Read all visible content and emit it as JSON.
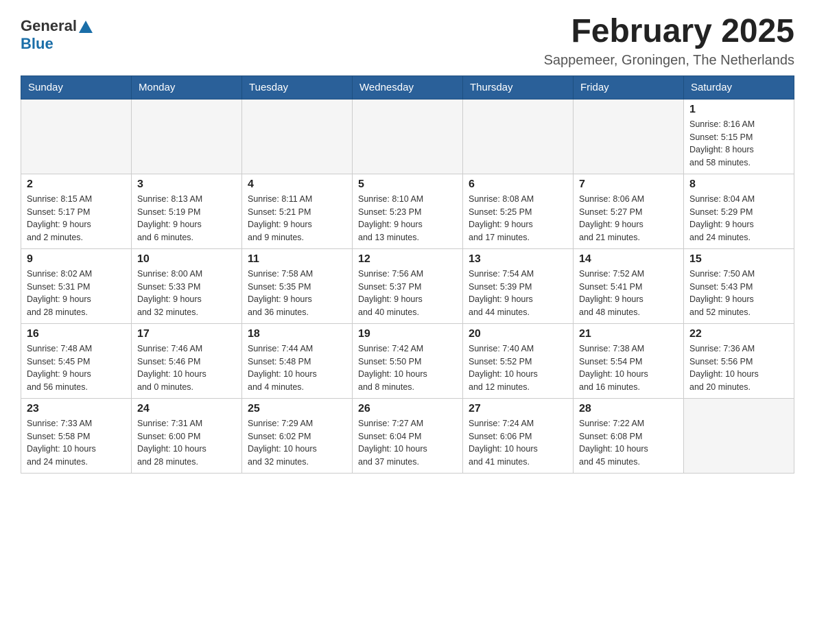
{
  "header": {
    "logo_general": "General",
    "logo_blue": "Blue",
    "title": "February 2025",
    "subtitle": "Sappemeer, Groningen, The Netherlands"
  },
  "weekdays": [
    "Sunday",
    "Monday",
    "Tuesday",
    "Wednesday",
    "Thursday",
    "Friday",
    "Saturday"
  ],
  "weeks": [
    [
      {
        "day": "",
        "info": ""
      },
      {
        "day": "",
        "info": ""
      },
      {
        "day": "",
        "info": ""
      },
      {
        "day": "",
        "info": ""
      },
      {
        "day": "",
        "info": ""
      },
      {
        "day": "",
        "info": ""
      },
      {
        "day": "1",
        "info": "Sunrise: 8:16 AM\nSunset: 5:15 PM\nDaylight: 8 hours\nand 58 minutes."
      }
    ],
    [
      {
        "day": "2",
        "info": "Sunrise: 8:15 AM\nSunset: 5:17 PM\nDaylight: 9 hours\nand 2 minutes."
      },
      {
        "day": "3",
        "info": "Sunrise: 8:13 AM\nSunset: 5:19 PM\nDaylight: 9 hours\nand 6 minutes."
      },
      {
        "day": "4",
        "info": "Sunrise: 8:11 AM\nSunset: 5:21 PM\nDaylight: 9 hours\nand 9 minutes."
      },
      {
        "day": "5",
        "info": "Sunrise: 8:10 AM\nSunset: 5:23 PM\nDaylight: 9 hours\nand 13 minutes."
      },
      {
        "day": "6",
        "info": "Sunrise: 8:08 AM\nSunset: 5:25 PM\nDaylight: 9 hours\nand 17 minutes."
      },
      {
        "day": "7",
        "info": "Sunrise: 8:06 AM\nSunset: 5:27 PM\nDaylight: 9 hours\nand 21 minutes."
      },
      {
        "day": "8",
        "info": "Sunrise: 8:04 AM\nSunset: 5:29 PM\nDaylight: 9 hours\nand 24 minutes."
      }
    ],
    [
      {
        "day": "9",
        "info": "Sunrise: 8:02 AM\nSunset: 5:31 PM\nDaylight: 9 hours\nand 28 minutes."
      },
      {
        "day": "10",
        "info": "Sunrise: 8:00 AM\nSunset: 5:33 PM\nDaylight: 9 hours\nand 32 minutes."
      },
      {
        "day": "11",
        "info": "Sunrise: 7:58 AM\nSunset: 5:35 PM\nDaylight: 9 hours\nand 36 minutes."
      },
      {
        "day": "12",
        "info": "Sunrise: 7:56 AM\nSunset: 5:37 PM\nDaylight: 9 hours\nand 40 minutes."
      },
      {
        "day": "13",
        "info": "Sunrise: 7:54 AM\nSunset: 5:39 PM\nDaylight: 9 hours\nand 44 minutes."
      },
      {
        "day": "14",
        "info": "Sunrise: 7:52 AM\nSunset: 5:41 PM\nDaylight: 9 hours\nand 48 minutes."
      },
      {
        "day": "15",
        "info": "Sunrise: 7:50 AM\nSunset: 5:43 PM\nDaylight: 9 hours\nand 52 minutes."
      }
    ],
    [
      {
        "day": "16",
        "info": "Sunrise: 7:48 AM\nSunset: 5:45 PM\nDaylight: 9 hours\nand 56 minutes."
      },
      {
        "day": "17",
        "info": "Sunrise: 7:46 AM\nSunset: 5:46 PM\nDaylight: 10 hours\nand 0 minutes."
      },
      {
        "day": "18",
        "info": "Sunrise: 7:44 AM\nSunset: 5:48 PM\nDaylight: 10 hours\nand 4 minutes."
      },
      {
        "day": "19",
        "info": "Sunrise: 7:42 AM\nSunset: 5:50 PM\nDaylight: 10 hours\nand 8 minutes."
      },
      {
        "day": "20",
        "info": "Sunrise: 7:40 AM\nSunset: 5:52 PM\nDaylight: 10 hours\nand 12 minutes."
      },
      {
        "day": "21",
        "info": "Sunrise: 7:38 AM\nSunset: 5:54 PM\nDaylight: 10 hours\nand 16 minutes."
      },
      {
        "day": "22",
        "info": "Sunrise: 7:36 AM\nSunset: 5:56 PM\nDaylight: 10 hours\nand 20 minutes."
      }
    ],
    [
      {
        "day": "23",
        "info": "Sunrise: 7:33 AM\nSunset: 5:58 PM\nDaylight: 10 hours\nand 24 minutes."
      },
      {
        "day": "24",
        "info": "Sunrise: 7:31 AM\nSunset: 6:00 PM\nDaylight: 10 hours\nand 28 minutes."
      },
      {
        "day": "25",
        "info": "Sunrise: 7:29 AM\nSunset: 6:02 PM\nDaylight: 10 hours\nand 32 minutes."
      },
      {
        "day": "26",
        "info": "Sunrise: 7:27 AM\nSunset: 6:04 PM\nDaylight: 10 hours\nand 37 minutes."
      },
      {
        "day": "27",
        "info": "Sunrise: 7:24 AM\nSunset: 6:06 PM\nDaylight: 10 hours\nand 41 minutes."
      },
      {
        "day": "28",
        "info": "Sunrise: 7:22 AM\nSunset: 6:08 PM\nDaylight: 10 hours\nand 45 minutes."
      },
      {
        "day": "",
        "info": ""
      }
    ]
  ]
}
